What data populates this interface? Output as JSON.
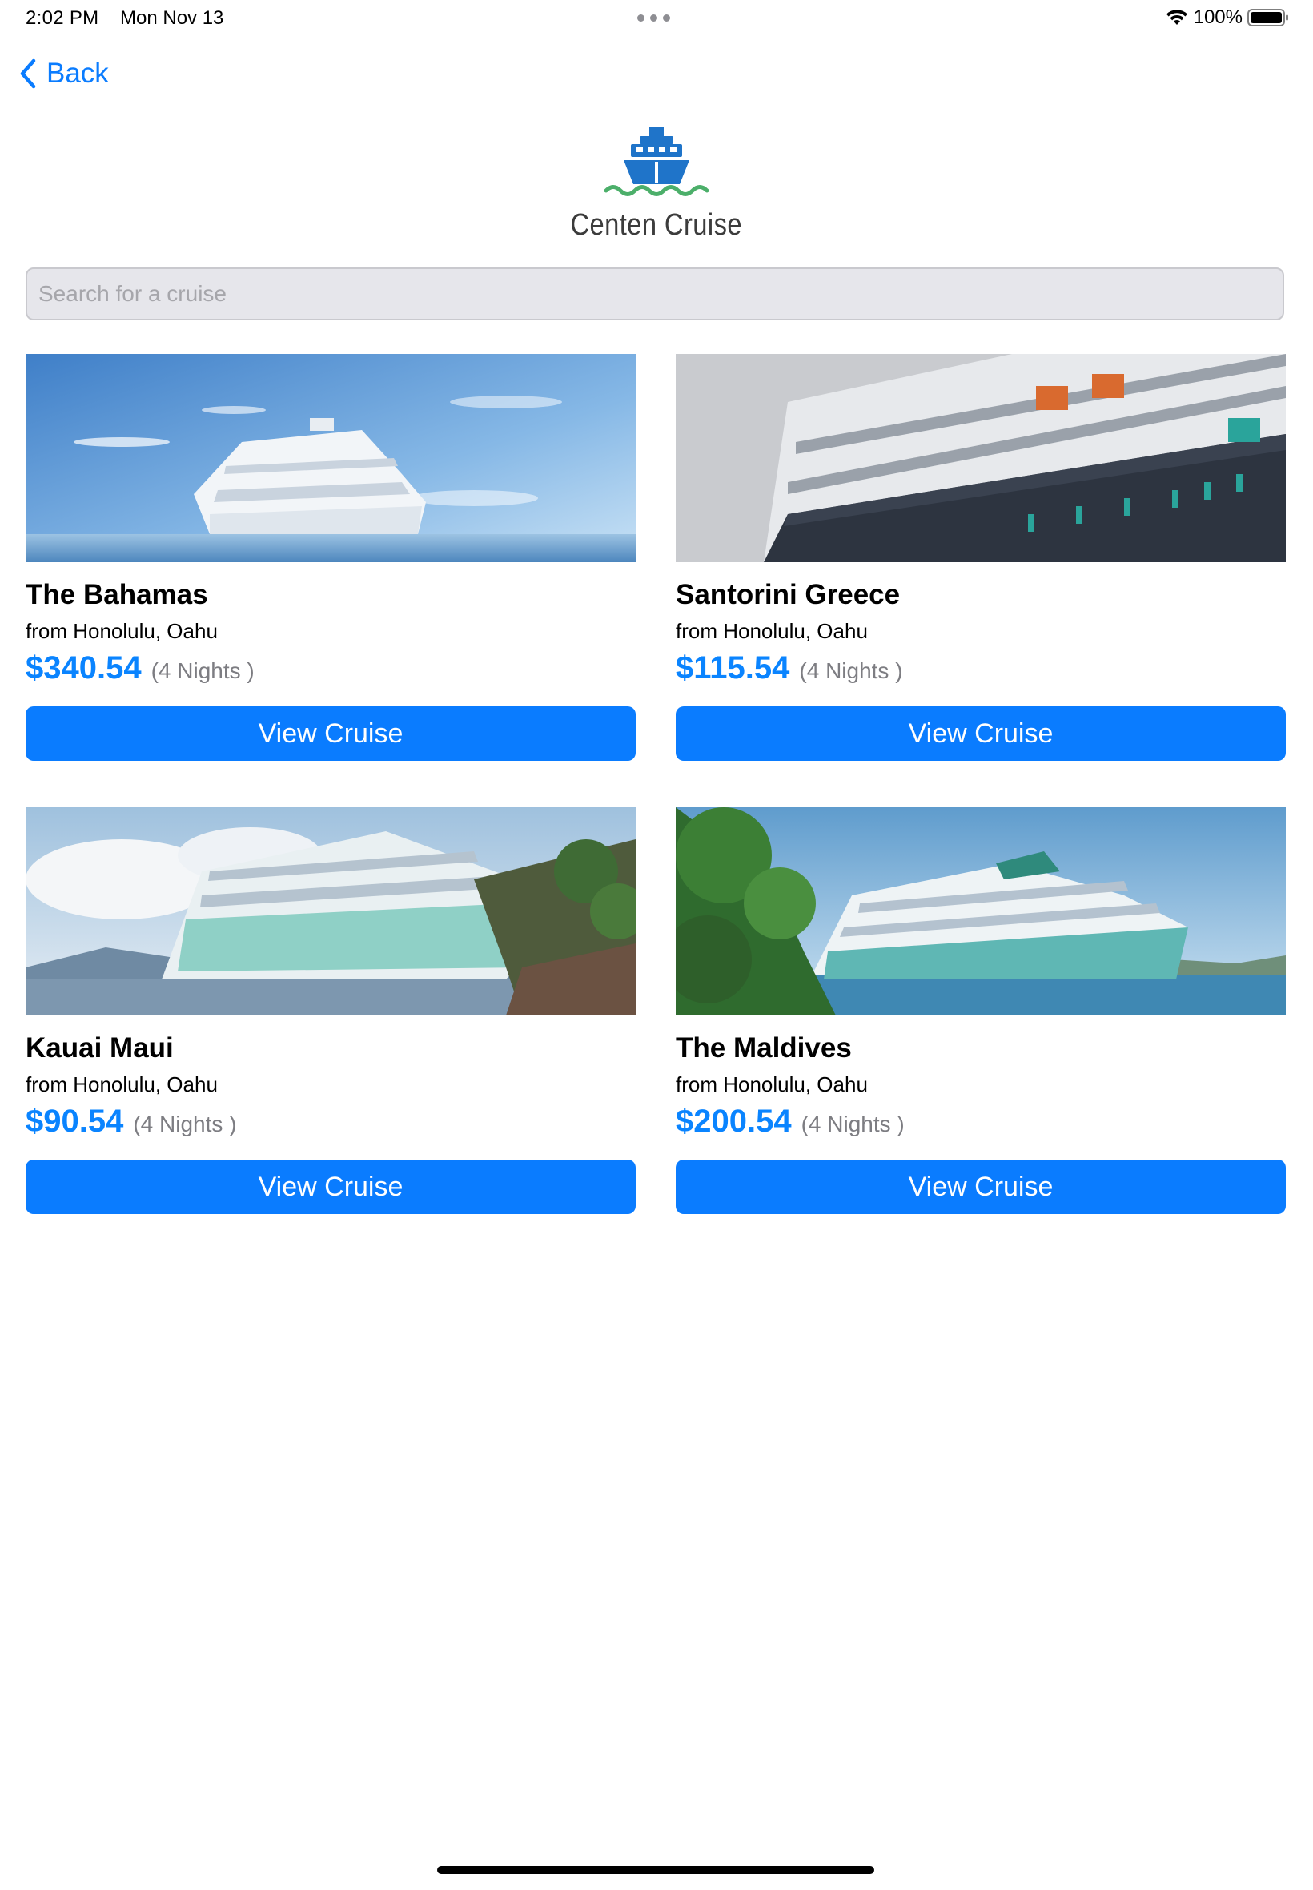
{
  "status_bar": {
    "time": "2:02 PM",
    "date": "Mon Nov 13",
    "battery": "100%"
  },
  "nav": {
    "back_label": "Back"
  },
  "logo": {
    "text": "Centen Cruise"
  },
  "search": {
    "placeholder": "Search for a cruise",
    "value": ""
  },
  "cruises": [
    {
      "title": "The Bahamas",
      "origin": "from Honolulu, Oahu",
      "price": "$340.54",
      "nights": "(4 Nights )",
      "button": "View Cruise",
      "image": "cruise-ship-open-ocean"
    },
    {
      "title": "Santorini Greece",
      "origin": "from Honolulu, Oahu",
      "price": "$115.54",
      "nights": "(4 Nights )",
      "button": "View Cruise",
      "image": "cruise-ship-hull-closeup"
    },
    {
      "title": "Kauai Maui",
      "origin": "from Honolulu, Oahu",
      "price": "$90.54",
      "nights": "(4 Nights )",
      "button": "View Cruise",
      "image": "cruise-ship-rocky-coast"
    },
    {
      "title": "The Maldives",
      "origin": "from Honolulu, Oahu",
      "price": "$200.54",
      "nights": "(4 Nights )",
      "button": "View Cruise",
      "image": "cruise-ship-tropical-island"
    }
  ],
  "colors": {
    "accent": "#0a7cff",
    "price": "#0a84ff",
    "logo_ship": "#1f74c9",
    "logo_wave": "#4caf6a"
  }
}
